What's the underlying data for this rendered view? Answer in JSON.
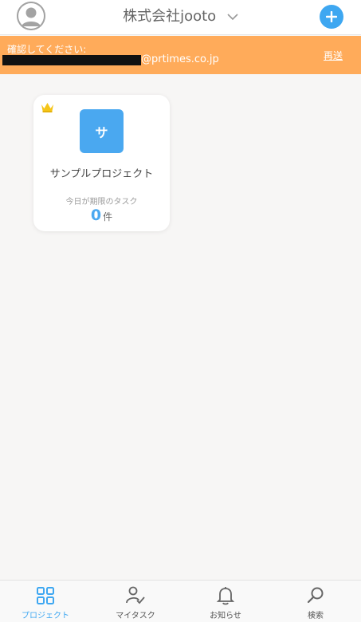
{
  "header": {
    "workspace_name": "株式会社jooto"
  },
  "banner": {
    "confirm_text": "確認してください:",
    "email_suffix": "@prtimes.co.jp",
    "resend_label": "再送"
  },
  "project_card": {
    "icon_letter": "サ",
    "name": "サンプルプロジェクト",
    "due_label": "今日が期限のタスク",
    "due_count": "0",
    "due_unit": "件"
  },
  "bottom_nav": {
    "items": [
      {
        "label": "プロジェクト",
        "icon": "grid-icon",
        "active": true
      },
      {
        "label": "マイタスク",
        "icon": "my-task-icon",
        "active": false
      },
      {
        "label": "お知らせ",
        "icon": "bell-icon",
        "active": false
      },
      {
        "label": "検索",
        "icon": "search-icon",
        "active": false
      }
    ]
  },
  "colors": {
    "accent": "#3ea7f1",
    "banner": "#ffab5a",
    "project_icon": "#4aa8f0",
    "crown": "#f5c518"
  }
}
